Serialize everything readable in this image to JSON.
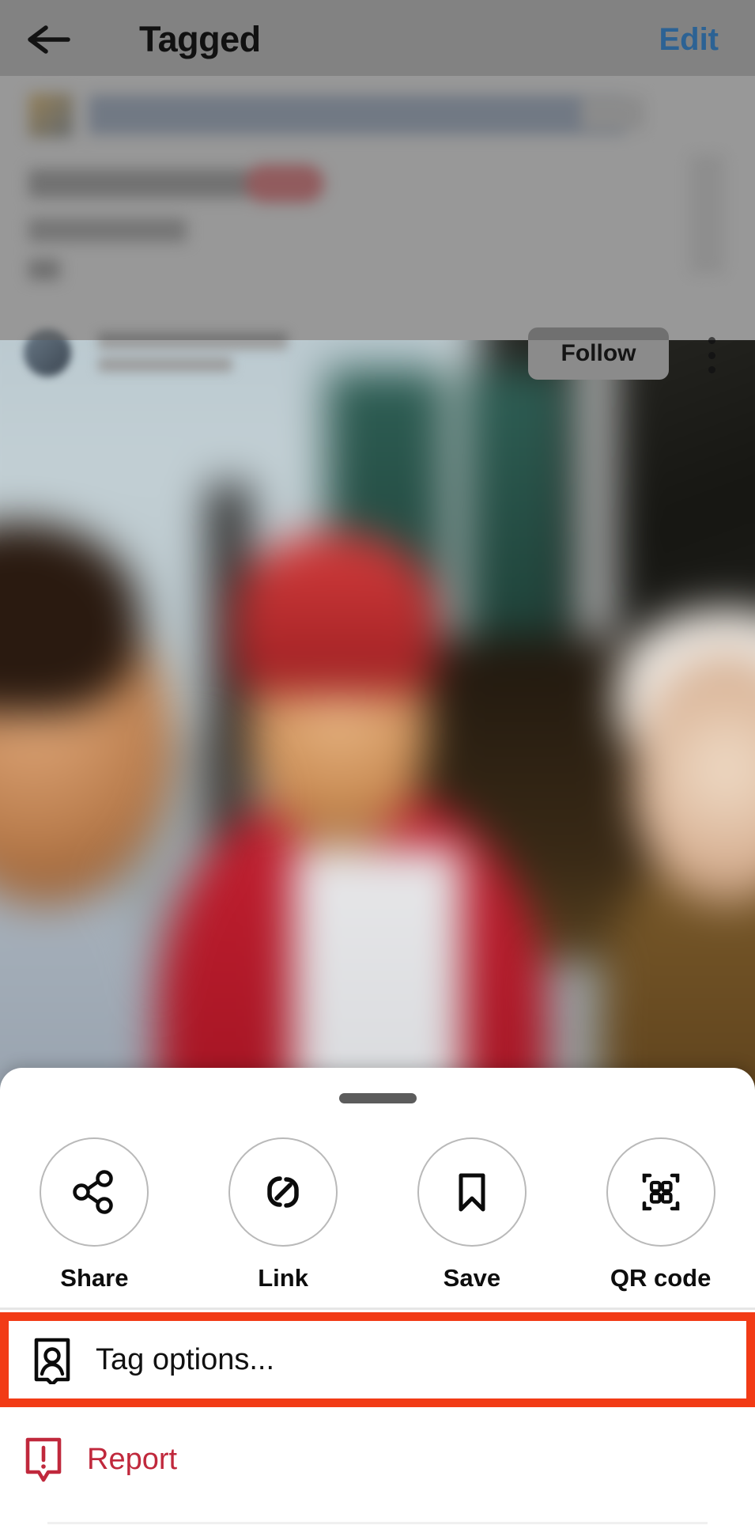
{
  "header": {
    "back_icon": "arrow-left-icon",
    "title": "Tagged",
    "edit_label": "Edit",
    "edit_color": "#2c6294",
    "background_color": "#828282"
  },
  "background_content": {
    "follow_button_label": "Follow",
    "overflow_icon": "kebab-menu-icon",
    "note": "blurred tagged-post list and photo behind modal"
  },
  "bottom_sheet": {
    "grabber": "drag-handle",
    "actions": [
      {
        "icon": "share-icon",
        "label": "Share"
      },
      {
        "icon": "link-icon",
        "label": "Link"
      },
      {
        "icon": "bookmark-icon",
        "label": "Save"
      },
      {
        "icon": "qr-code-icon",
        "label": "QR code"
      }
    ],
    "menu_items": [
      {
        "icon": "tag-person-icon",
        "label": "Tag options...",
        "highlighted": true,
        "highlight_color": "#f23b16",
        "text_color": "#111111"
      },
      {
        "icon": "report-icon",
        "label": "Report",
        "highlighted": false,
        "text_color": "#c0283c"
      }
    ]
  }
}
